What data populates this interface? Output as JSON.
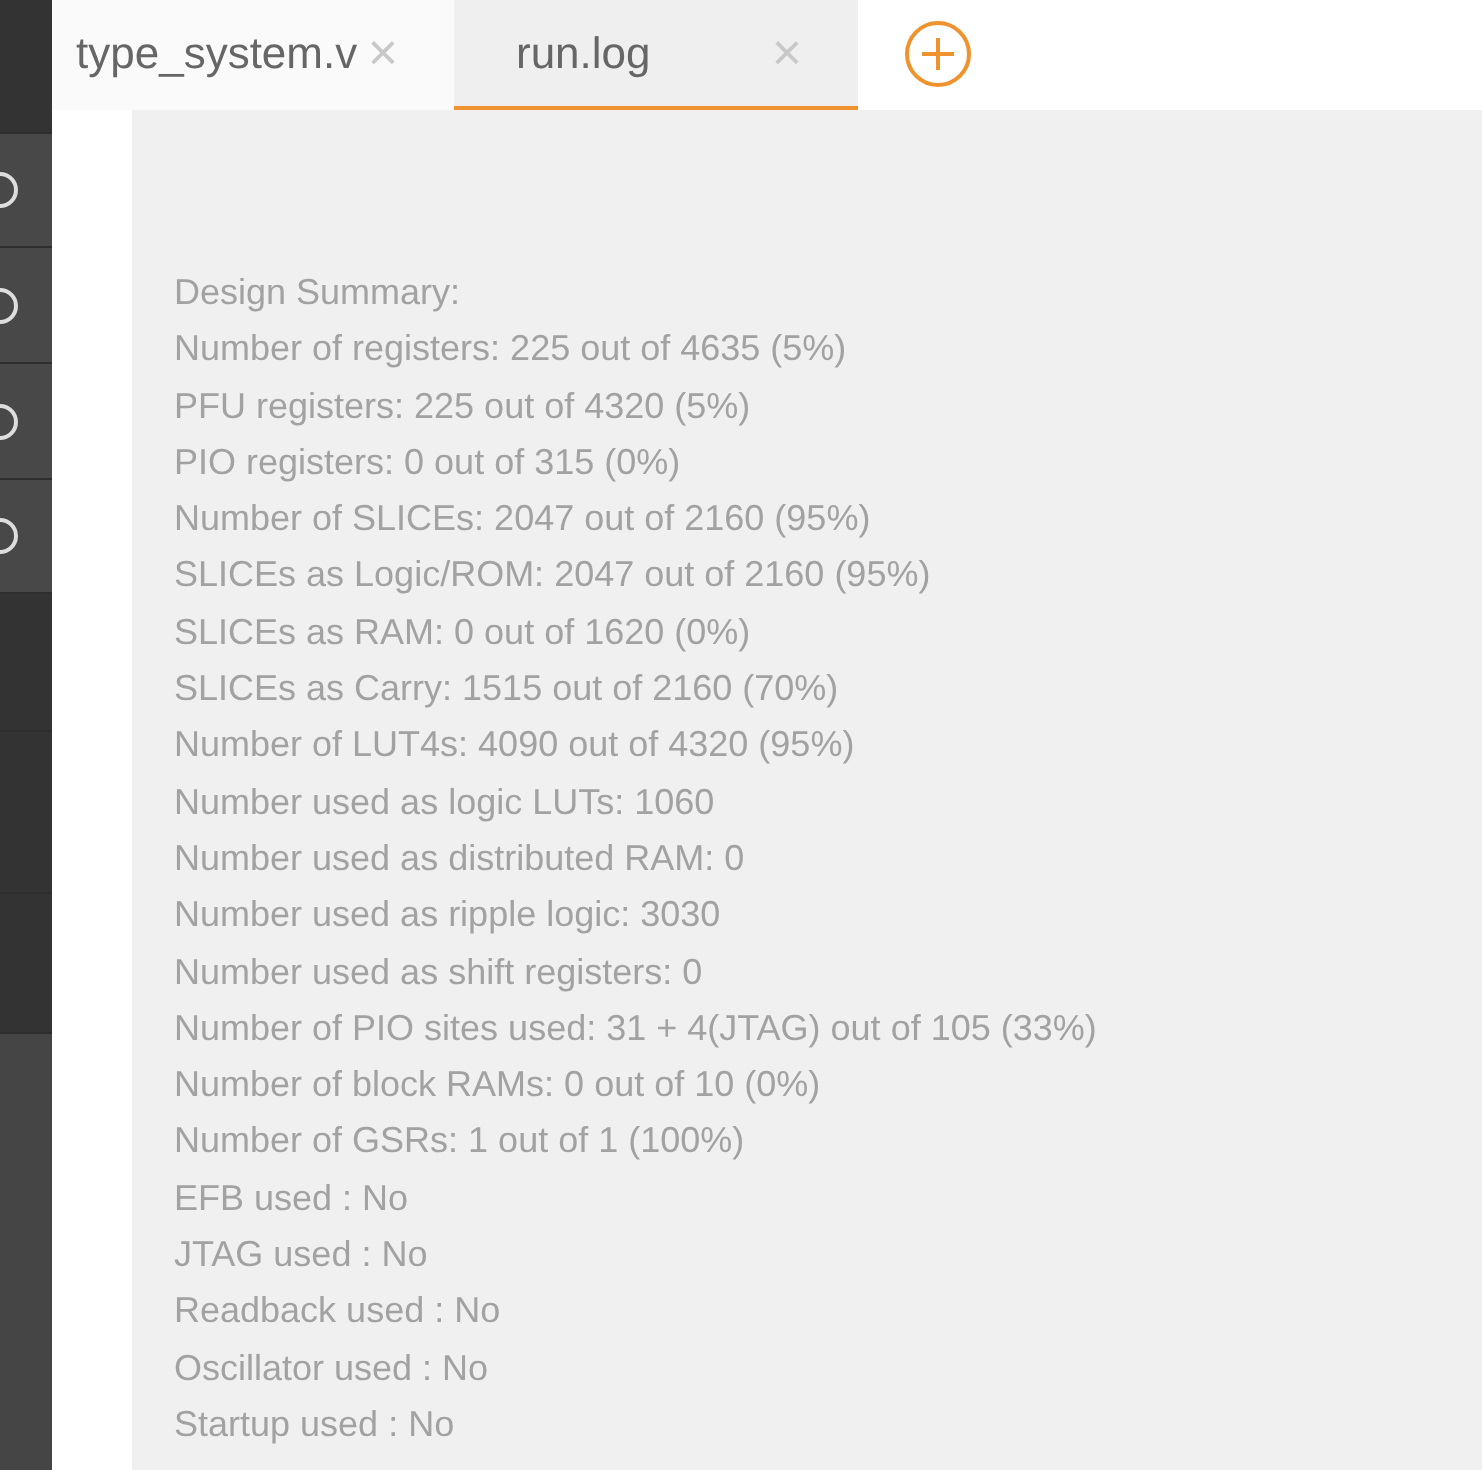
{
  "sidebar": {
    "items": [
      {
        "kind": "plain"
      },
      {
        "kind": "radio"
      },
      {
        "kind": "radio"
      },
      {
        "kind": "radio"
      },
      {
        "kind": "radio"
      },
      {
        "kind": "plain"
      },
      {
        "kind": "plain"
      },
      {
        "kind": "plain"
      }
    ]
  },
  "tabs": [
    {
      "label": "type_system.v",
      "close": "×",
      "selected": false
    },
    {
      "label": "run.log",
      "close": "×",
      "selected": true
    }
  ],
  "log_lines": [
    "Design Summary:",
    "Number of registers: 225 out of 4635 (5%)",
    "PFU registers: 225 out of 4320 (5%)",
    "PIO registers: 0 out of 315 (0%)",
    "Number of SLICEs: 2047 out of 2160 (95%)",
    "SLICEs as Logic/ROM: 2047 out of 2160 (95%)",
    "SLICEs as RAM: 0 out of 1620 (0%)",
    "SLICEs as Carry: 1515 out of 2160 (70%)",
    "Number of LUT4s: 4090 out of 4320 (95%)",
    "Number used as logic LUTs: 1060",
    "Number used as distributed RAM: 0",
    "Number used as ripple logic: 3030",
    "Number used as shift registers: 0",
    "Number of PIO sites used: 31 + 4(JTAG) out of 105 (33%)",
    "Number of block RAMs: 0 out of 10 (0%)",
    "Number of GSRs: 1 out of 1 (100%)",
    "EFB used : No",
    "JTAG used : No",
    "Readback used : No",
    "Oscillator used : No",
    "Startup used : No"
  ]
}
